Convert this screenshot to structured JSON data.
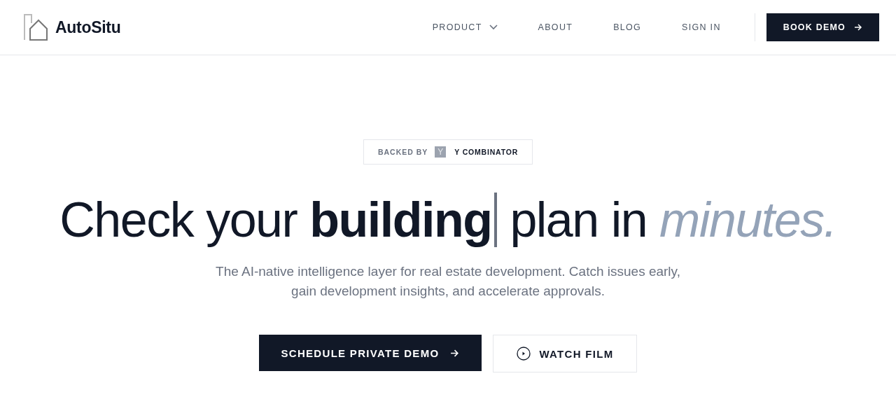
{
  "header": {
    "brand": "AutoSitu",
    "nav": [
      {
        "label": "PRODUCT",
        "dropdown": true
      },
      {
        "label": "ABOUT",
        "dropdown": false
      },
      {
        "label": "BLOG",
        "dropdown": false
      },
      {
        "label": "SIGN IN",
        "dropdown": false
      }
    ],
    "cta": "BOOK DEMO"
  },
  "hero": {
    "badge": {
      "prefix": "BACKED BY",
      "logo_letter": "Y",
      "name": "Y COMBINATOR"
    },
    "headline": "Check your **building** plan in *minutes.*",
    "subtitle": "The AI-native intelligence layer for real estate development. Catch issues early, gain development insights, and accelerate approvals.",
    "buttons": [
      {
        "label": "SCHEDULE PRIVATE DEMO",
        "kind": "primary"
      },
      {
        "label": "WATCH FILM",
        "kind": "secondary"
      }
    ]
  }
}
